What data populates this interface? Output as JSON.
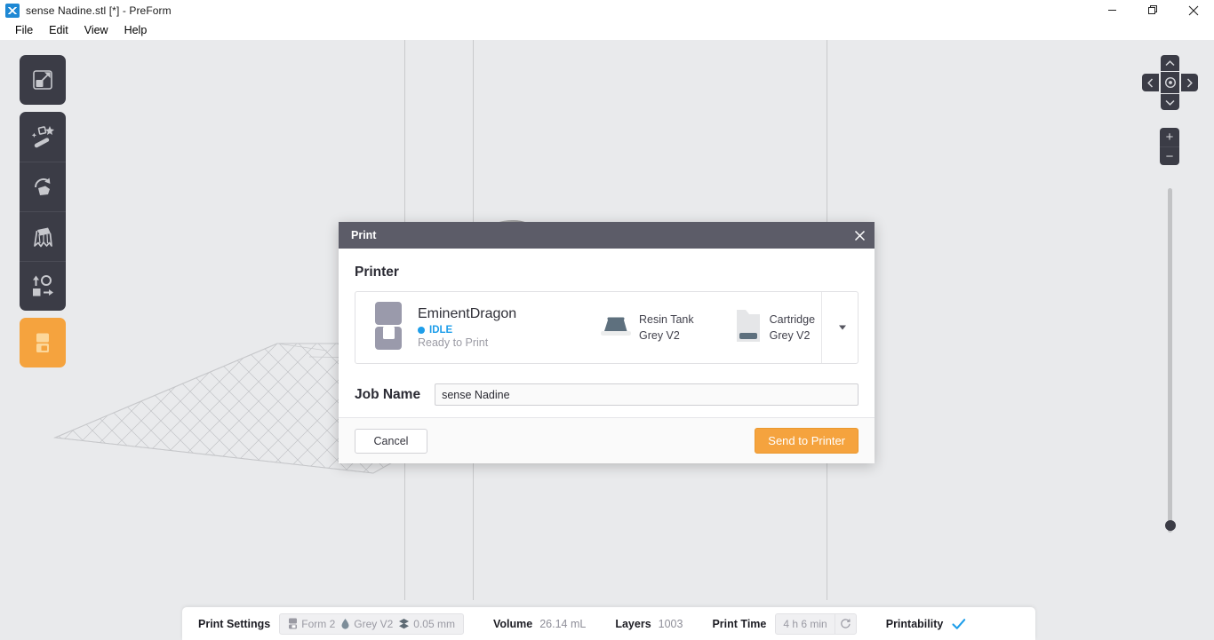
{
  "window": {
    "title": "sense Nadine.stl [*] - PreForm",
    "icon": "preform-app-icon",
    "controls": {
      "minimize": "minimize-icon",
      "restore": "restore-icon",
      "close": "close-icon"
    }
  },
  "menubar": {
    "items": [
      {
        "label": "File"
      },
      {
        "label": "Edit"
      },
      {
        "label": "View"
      },
      {
        "label": "Help"
      }
    ]
  },
  "toolbar": {
    "items": [
      {
        "name": "size-tool",
        "icon": "scale-arrow-icon"
      },
      {
        "name": "one-click-print-tool",
        "icon": "magic-wand-icon"
      },
      {
        "name": "orientation-tool",
        "icon": "rotate-object-icon"
      },
      {
        "name": "supports-tool",
        "icon": "supports-icon"
      },
      {
        "name": "layout-tool",
        "icon": "layout-arrange-icon"
      },
      {
        "name": "print-tool",
        "icon": "printer-icon",
        "active": true
      }
    ]
  },
  "view_controls": {
    "up": "chevron-up-icon",
    "down": "chevron-down-icon",
    "left": "chevron-left-icon",
    "right": "chevron-right-icon",
    "home": "view-home-icon",
    "zoom_in": "+",
    "zoom_out": "−"
  },
  "dialog": {
    "title": "Print",
    "close_icon": "close-icon",
    "section_title": "Printer",
    "printer": {
      "name": "EminentDragon",
      "status": "IDLE",
      "status_color": "#1e9eea",
      "sub_status": "Ready to Print",
      "tank": {
        "label": "Resin Tank",
        "material": "Grey V2"
      },
      "cartridge": {
        "label": "Cartridge",
        "material": "Grey V2"
      },
      "dropdown_icon": "caret-down-icon"
    },
    "job_name": {
      "label": "Job Name",
      "value": "sense Nadine",
      "placeholder": "Job Name"
    },
    "buttons": {
      "cancel": "Cancel",
      "send": "Send to Printer"
    },
    "accent_color": "#f5a33e",
    "header_color": "#5c5c68"
  },
  "statusbar": {
    "print_settings_label": "Print Settings",
    "printer_model": "Form 2",
    "material": "Grey V2",
    "layer_height": "0.05 mm",
    "volume_label": "Volume",
    "volume_value": "26.14 mL",
    "layers_label": "Layers",
    "layers_value": "1003",
    "print_time_label": "Print Time",
    "print_time_value": "4 h 6 min",
    "refresh_icon": "refresh-icon",
    "printability_label": "Printability",
    "printability_icon": "check-icon",
    "printability_color": "#1e9eea"
  }
}
